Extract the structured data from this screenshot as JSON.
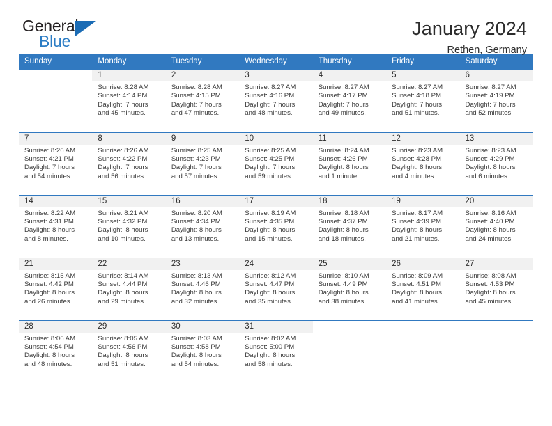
{
  "brand": {
    "name_part1": "General",
    "name_part2": "Blue",
    "color_dark": "#231f20",
    "color_blue": "#2b7cc4"
  },
  "header": {
    "title": "January 2024",
    "location": "Rethen, Germany"
  },
  "theme": {
    "header_bg": "#3179c0",
    "header_text": "#ffffff",
    "datenum_bg": "#f1f1f1",
    "grid_line": "#3179c0"
  },
  "weekday_headers": [
    "Sunday",
    "Monday",
    "Tuesday",
    "Wednesday",
    "Thursday",
    "Friday",
    "Saturday"
  ],
  "weeks": [
    [
      {
        "day": "",
        "sunrise": "",
        "sunset": "",
        "daylight1": "",
        "daylight2": ""
      },
      {
        "day": "1",
        "sunrise": "Sunrise: 8:28 AM",
        "sunset": "Sunset: 4:14 PM",
        "daylight1": "Daylight: 7 hours",
        "daylight2": "and 45 minutes."
      },
      {
        "day": "2",
        "sunrise": "Sunrise: 8:28 AM",
        "sunset": "Sunset: 4:15 PM",
        "daylight1": "Daylight: 7 hours",
        "daylight2": "and 47 minutes."
      },
      {
        "day": "3",
        "sunrise": "Sunrise: 8:27 AM",
        "sunset": "Sunset: 4:16 PM",
        "daylight1": "Daylight: 7 hours",
        "daylight2": "and 48 minutes."
      },
      {
        "day": "4",
        "sunrise": "Sunrise: 8:27 AM",
        "sunset": "Sunset: 4:17 PM",
        "daylight1": "Daylight: 7 hours",
        "daylight2": "and 49 minutes."
      },
      {
        "day": "5",
        "sunrise": "Sunrise: 8:27 AM",
        "sunset": "Sunset: 4:18 PM",
        "daylight1": "Daylight: 7 hours",
        "daylight2": "and 51 minutes."
      },
      {
        "day": "6",
        "sunrise": "Sunrise: 8:27 AM",
        "sunset": "Sunset: 4:19 PM",
        "daylight1": "Daylight: 7 hours",
        "daylight2": "and 52 minutes."
      }
    ],
    [
      {
        "day": "7",
        "sunrise": "Sunrise: 8:26 AM",
        "sunset": "Sunset: 4:21 PM",
        "daylight1": "Daylight: 7 hours",
        "daylight2": "and 54 minutes."
      },
      {
        "day": "8",
        "sunrise": "Sunrise: 8:26 AM",
        "sunset": "Sunset: 4:22 PM",
        "daylight1": "Daylight: 7 hours",
        "daylight2": "and 56 minutes."
      },
      {
        "day": "9",
        "sunrise": "Sunrise: 8:25 AM",
        "sunset": "Sunset: 4:23 PM",
        "daylight1": "Daylight: 7 hours",
        "daylight2": "and 57 minutes."
      },
      {
        "day": "10",
        "sunrise": "Sunrise: 8:25 AM",
        "sunset": "Sunset: 4:25 PM",
        "daylight1": "Daylight: 7 hours",
        "daylight2": "and 59 minutes."
      },
      {
        "day": "11",
        "sunrise": "Sunrise: 8:24 AM",
        "sunset": "Sunset: 4:26 PM",
        "daylight1": "Daylight: 8 hours",
        "daylight2": "and 1 minute."
      },
      {
        "day": "12",
        "sunrise": "Sunrise: 8:23 AM",
        "sunset": "Sunset: 4:28 PM",
        "daylight1": "Daylight: 8 hours",
        "daylight2": "and 4 minutes."
      },
      {
        "day": "13",
        "sunrise": "Sunrise: 8:23 AM",
        "sunset": "Sunset: 4:29 PM",
        "daylight1": "Daylight: 8 hours",
        "daylight2": "and 6 minutes."
      }
    ],
    [
      {
        "day": "14",
        "sunrise": "Sunrise: 8:22 AM",
        "sunset": "Sunset: 4:31 PM",
        "daylight1": "Daylight: 8 hours",
        "daylight2": "and 8 minutes."
      },
      {
        "day": "15",
        "sunrise": "Sunrise: 8:21 AM",
        "sunset": "Sunset: 4:32 PM",
        "daylight1": "Daylight: 8 hours",
        "daylight2": "and 10 minutes."
      },
      {
        "day": "16",
        "sunrise": "Sunrise: 8:20 AM",
        "sunset": "Sunset: 4:34 PM",
        "daylight1": "Daylight: 8 hours",
        "daylight2": "and 13 minutes."
      },
      {
        "day": "17",
        "sunrise": "Sunrise: 8:19 AM",
        "sunset": "Sunset: 4:35 PM",
        "daylight1": "Daylight: 8 hours",
        "daylight2": "and 15 minutes."
      },
      {
        "day": "18",
        "sunrise": "Sunrise: 8:18 AM",
        "sunset": "Sunset: 4:37 PM",
        "daylight1": "Daylight: 8 hours",
        "daylight2": "and 18 minutes."
      },
      {
        "day": "19",
        "sunrise": "Sunrise: 8:17 AM",
        "sunset": "Sunset: 4:39 PM",
        "daylight1": "Daylight: 8 hours",
        "daylight2": "and 21 minutes."
      },
      {
        "day": "20",
        "sunrise": "Sunrise: 8:16 AM",
        "sunset": "Sunset: 4:40 PM",
        "daylight1": "Daylight: 8 hours",
        "daylight2": "and 24 minutes."
      }
    ],
    [
      {
        "day": "21",
        "sunrise": "Sunrise: 8:15 AM",
        "sunset": "Sunset: 4:42 PM",
        "daylight1": "Daylight: 8 hours",
        "daylight2": "and 26 minutes."
      },
      {
        "day": "22",
        "sunrise": "Sunrise: 8:14 AM",
        "sunset": "Sunset: 4:44 PM",
        "daylight1": "Daylight: 8 hours",
        "daylight2": "and 29 minutes."
      },
      {
        "day": "23",
        "sunrise": "Sunrise: 8:13 AM",
        "sunset": "Sunset: 4:46 PM",
        "daylight1": "Daylight: 8 hours",
        "daylight2": "and 32 minutes."
      },
      {
        "day": "24",
        "sunrise": "Sunrise: 8:12 AM",
        "sunset": "Sunset: 4:47 PM",
        "daylight1": "Daylight: 8 hours",
        "daylight2": "and 35 minutes."
      },
      {
        "day": "25",
        "sunrise": "Sunrise: 8:10 AM",
        "sunset": "Sunset: 4:49 PM",
        "daylight1": "Daylight: 8 hours",
        "daylight2": "and 38 minutes."
      },
      {
        "day": "26",
        "sunrise": "Sunrise: 8:09 AM",
        "sunset": "Sunset: 4:51 PM",
        "daylight1": "Daylight: 8 hours",
        "daylight2": "and 41 minutes."
      },
      {
        "day": "27",
        "sunrise": "Sunrise: 8:08 AM",
        "sunset": "Sunset: 4:53 PM",
        "daylight1": "Daylight: 8 hours",
        "daylight2": "and 45 minutes."
      }
    ],
    [
      {
        "day": "28",
        "sunrise": "Sunrise: 8:06 AM",
        "sunset": "Sunset: 4:54 PM",
        "daylight1": "Daylight: 8 hours",
        "daylight2": "and 48 minutes."
      },
      {
        "day": "29",
        "sunrise": "Sunrise: 8:05 AM",
        "sunset": "Sunset: 4:56 PM",
        "daylight1": "Daylight: 8 hours",
        "daylight2": "and 51 minutes."
      },
      {
        "day": "30",
        "sunrise": "Sunrise: 8:03 AM",
        "sunset": "Sunset: 4:58 PM",
        "daylight1": "Daylight: 8 hours",
        "daylight2": "and 54 minutes."
      },
      {
        "day": "31",
        "sunrise": "Sunrise: 8:02 AM",
        "sunset": "Sunset: 5:00 PM",
        "daylight1": "Daylight: 8 hours",
        "daylight2": "and 58 minutes."
      },
      {
        "day": "",
        "sunrise": "",
        "sunset": "",
        "daylight1": "",
        "daylight2": ""
      },
      {
        "day": "",
        "sunrise": "",
        "sunset": "",
        "daylight1": "",
        "daylight2": ""
      },
      {
        "day": "",
        "sunrise": "",
        "sunset": "",
        "daylight1": "",
        "daylight2": ""
      }
    ]
  ]
}
